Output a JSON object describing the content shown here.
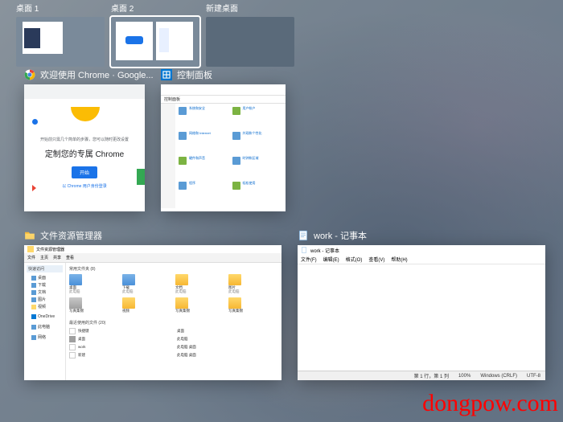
{
  "desktops": {
    "labels": [
      "桌面 1",
      "桌面 2",
      "新建桌面"
    ]
  },
  "chrome": {
    "title": "欢迎使用 Chrome · Google...",
    "subtitle": "开始前只需几个简单的步骤，您可以随时更改设置",
    "heading": "定制您的专属 Chrome",
    "button": "开始",
    "link": "以 Chrome 用户身份登录"
  },
  "controlPanel": {
    "title": "控制面板",
    "bar": "控制面板",
    "items": [
      "系统和安全",
      "用户帐户",
      "网络和 Internet",
      "外观和个性化",
      "硬件和声音",
      "时钟和区域",
      "程序",
      "轻松使用"
    ]
  },
  "explorer": {
    "title": "文件资源管理器",
    "tb": "文件资源管理器",
    "ribbon": [
      "文件",
      "主页",
      "共享",
      "查看"
    ],
    "quick": "快速访问",
    "sideItems": [
      "桌面",
      "下载",
      "文档",
      "图片",
      "视频",
      "此电脑",
      "网络"
    ],
    "sidePc": "OneDrive",
    "sideThis": "此电脑",
    "sideNet": "网络",
    "sec1": "常用文件夹 (8)",
    "folders": [
      "桌面",
      "下载",
      "文档",
      "图片",
      "写真集锦",
      "视频",
      "写真集锦",
      "写真集锦"
    ],
    "sub": "此电脑",
    "sec2": "最近使用的文件 (20)",
    "recent": [
      {
        "name": "快捷键",
        "path": "桌面"
      },
      {
        "name": "桌面",
        "path": "此电脑"
      },
      {
        "name": "work",
        "path": "此电脑 桌面"
      },
      {
        "name": "新建",
        "path": "此电脑 桌面"
      },
      {
        "name": " ",
        "path": "此电脑 桌面"
      }
    ]
  },
  "notepad": {
    "title": "work - 记事本",
    "tb": "work - 记事本",
    "menu": [
      "文件(F)",
      "编辑(E)",
      "格式(O)",
      "查看(V)",
      "帮助(H)"
    ],
    "status": {
      "pos": "第 1 行，第 1 列",
      "zoom": "100%",
      "eol": "Windows (CRLF)",
      "enc": "UTF-8"
    }
  },
  "watermark": "dongpow.com"
}
